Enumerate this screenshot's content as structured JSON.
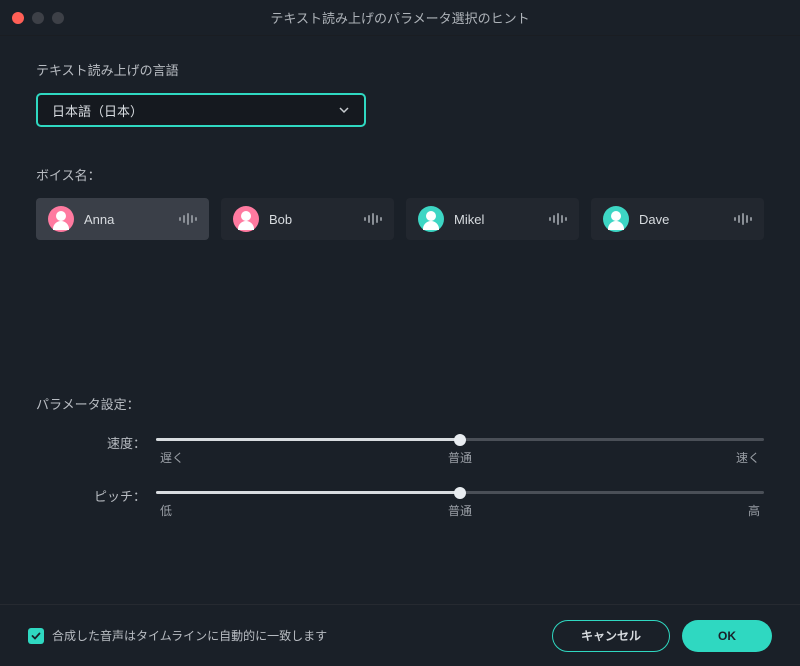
{
  "titlebar": {
    "title": "テキスト読み上げのパラメータ選択のヒント"
  },
  "language": {
    "label": "テキスト読み上げの言語",
    "selected": "日本語（日本）"
  },
  "voice": {
    "label": "ボイス名：",
    "options": [
      {
        "name": "Anna",
        "avatar_bg": "#ff7aa0",
        "selected": true
      },
      {
        "name": "Bob",
        "avatar_bg": "#ff7aa0",
        "selected": false
      },
      {
        "name": "Mikel",
        "avatar_bg": "#3dd6c4",
        "selected": false
      },
      {
        "name": "Dave",
        "avatar_bg": "#3dd6c4",
        "selected": false
      }
    ]
  },
  "params": {
    "label": "パラメータ設定：",
    "speed": {
      "label": "速度：",
      "slow": "遅く",
      "normal": "普通",
      "fast": "速く",
      "value": 50
    },
    "pitch": {
      "label": "ピッチ：",
      "low": "低",
      "normal": "普通",
      "high": "高",
      "value": 50
    }
  },
  "footer": {
    "checkbox_label": "合成した音声はタイムラインに自動的に一致します",
    "checkbox_checked": true,
    "cancel": "キャンセル",
    "ok": "OK"
  }
}
